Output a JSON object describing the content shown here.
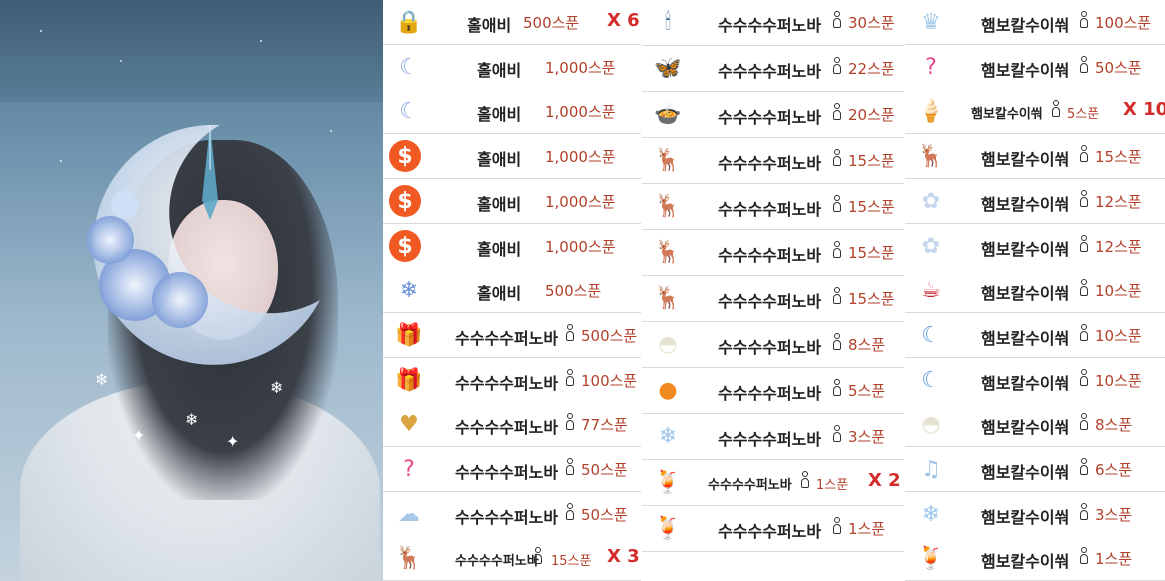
{
  "photo": {
    "description_hidden": ""
  },
  "columns": [
    {
      "rows": [
        {
          "icon": "heart-lock-icon",
          "name": "홀애비",
          "amount": "500스푼",
          "mult": "X 6",
          "person": false
        },
        {
          "icon": "moon-flower-icon",
          "name": "홀애비",
          "amount": "1,000스푼",
          "mult": "",
          "person": false
        },
        {
          "icon": "moon-flower-icon",
          "name": "홀애비",
          "amount": "1,000스푼",
          "mult": "",
          "person": false
        },
        {
          "icon": "spoon-coin-icon",
          "name": "홀애비",
          "amount": "1,000스푼",
          "mult": "",
          "person": false
        },
        {
          "icon": "spoon-coin-icon",
          "name": "홀애비",
          "amount": "1,000스푼",
          "mult": "",
          "person": false
        },
        {
          "icon": "spoon-coin-icon",
          "name": "홀애비",
          "amount": "1,000스푼",
          "mult": "",
          "person": false
        },
        {
          "icon": "ornament-garland-icon",
          "name": "홀애비",
          "amount": "500스푼",
          "mult": "",
          "person": false
        },
        {
          "icon": "gift-box-icon",
          "name": "수수수수퍼노바",
          "amount": "500스푼",
          "mult": "",
          "person": true
        },
        {
          "icon": "gift-box-icon",
          "name": "수수수수퍼노바",
          "amount": "100스푼",
          "mult": "",
          "person": true
        },
        {
          "icon": "golden-heart-icon",
          "name": "수수수수퍼노바",
          "amount": "77스푼",
          "mult": "",
          "person": true
        },
        {
          "icon": "question-mark-icon",
          "name": "수수수수퍼노바",
          "amount": "50스푼",
          "mult": "",
          "person": true
        },
        {
          "icon": "cloud-icon",
          "name": "수수수수퍼노바",
          "amount": "50스푼",
          "mult": "",
          "person": true
        },
        {
          "icon": "deer-icon",
          "name": "수수수수퍼노바",
          "amount": "15스푼",
          "mult": "X 3",
          "person": true,
          "small": true
        }
      ]
    },
    {
      "rows": [
        {
          "icon": "candle-icon",
          "name": "수수수수퍼노바",
          "amount": "30스푼",
          "mult": "",
          "person": true
        },
        {
          "icon": "butterfly-icon",
          "name": "수수수수퍼노바",
          "amount": "22스푼",
          "mult": "",
          "person": true
        },
        {
          "icon": "soup-pot-icon",
          "name": "수수수수퍼노바",
          "amount": "20스푼",
          "mult": "",
          "person": true
        },
        {
          "icon": "deer-icon",
          "name": "수수수수퍼노바",
          "amount": "15스푼",
          "mult": "",
          "person": true
        },
        {
          "icon": "deer-icon",
          "name": "수수수수퍼노바",
          "amount": "15스푼",
          "mult": "",
          "person": true
        },
        {
          "icon": "deer-icon",
          "name": "수수수수퍼노바",
          "amount": "15스푼",
          "mult": "",
          "person": true
        },
        {
          "icon": "deer-icon",
          "name": "수수수수퍼노바",
          "amount": "15스푼",
          "mult": "",
          "person": true
        },
        {
          "icon": "dumpling-icon",
          "name": "수수수수퍼노바",
          "amount": "8스푼",
          "mult": "",
          "person": true
        },
        {
          "icon": "tangerine-icon",
          "name": "수수수수퍼노바",
          "amount": "5스푼",
          "mult": "",
          "person": true
        },
        {
          "icon": "snowflake-icon",
          "name": "수수수수퍼노바",
          "amount": "3스푼",
          "mult": "",
          "person": true
        },
        {
          "icon": "fruit-tea-icon",
          "name": "수수수수퍼노바",
          "amount": "1스푼",
          "mult": "X 2",
          "person": true,
          "small": true
        },
        {
          "icon": "fruit-tea-icon",
          "name": "수수수수퍼노바",
          "amount": "1스푼",
          "mult": "",
          "person": true
        }
      ]
    },
    {
      "rows": [
        {
          "icon": "crown-icon",
          "name": "햄보칼수이쒀",
          "amount": "100스푼",
          "mult": "",
          "person": true
        },
        {
          "icon": "question-mark-icon",
          "name": "햄보칼수이쒀",
          "amount": "50스푼",
          "mult": "",
          "person": true
        },
        {
          "icon": "ice-cream-icon",
          "name": "햄보칼수이쒀",
          "amount": "5스푼",
          "mult": "X 10",
          "person": true,
          "small": true
        },
        {
          "icon": "deer-icon",
          "name": "햄보칼수이쒀",
          "amount": "15스푼",
          "mult": "",
          "person": true
        },
        {
          "icon": "rose-icon",
          "name": "햄보칼수이쒀",
          "amount": "12스푼",
          "mult": "",
          "person": true
        },
        {
          "icon": "rose-icon",
          "name": "햄보칼수이쒀",
          "amount": "12스푼",
          "mult": "",
          "person": true
        },
        {
          "icon": "hot-cocoa-icon",
          "name": "햄보칼수이쒀",
          "amount": "10스푼",
          "mult": "",
          "person": true
        },
        {
          "icon": "crescent-moon-icon",
          "name": "햄보칼수이쒀",
          "amount": "10스푼",
          "mult": "",
          "person": true
        },
        {
          "icon": "crescent-moon-icon",
          "name": "햄보칼수이쒀",
          "amount": "10스푼",
          "mult": "",
          "person": true
        },
        {
          "icon": "dumpling-icon",
          "name": "햄보칼수이쒀",
          "amount": "8스푼",
          "mult": "",
          "person": true
        },
        {
          "icon": "music-note-icon",
          "name": "햄보칼수이쒀",
          "amount": "6스푼",
          "mult": "",
          "person": true
        },
        {
          "icon": "snowflake-icon",
          "name": "햄보칼수이쒀",
          "amount": "3스푼",
          "mult": "",
          "person": true
        },
        {
          "icon": "fruit-tea-icon",
          "name": "햄보칼수이쒀",
          "amount": "1스푼",
          "mult": "",
          "person": true
        }
      ]
    }
  ]
}
